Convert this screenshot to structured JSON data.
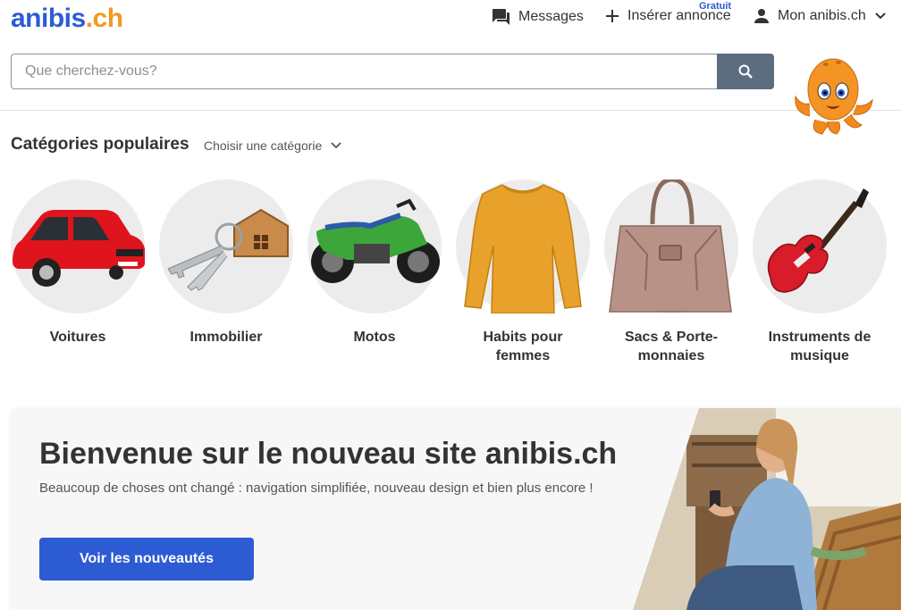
{
  "header": {
    "logo_part1": "anibis",
    "logo_part2": ".ch",
    "nav": {
      "messages": "Messages",
      "insert": "Insérer annonce",
      "insert_badge": "Gratuit",
      "account": "Mon anibis.ch"
    },
    "search": {
      "placeholder": "Que cherchez-vous?"
    }
  },
  "categories": {
    "title": "Catégories populaires",
    "select_label": "Choisir une catégorie",
    "items": [
      {
        "label": "Voitures"
      },
      {
        "label": "Immobilier"
      },
      {
        "label": "Motos"
      },
      {
        "label": "Habits pour femmes"
      },
      {
        "label": "Sacs & Porte-monnaies"
      },
      {
        "label": "Instruments de musique"
      }
    ]
  },
  "banner": {
    "title": "Bienvenue sur le nouveau site anibis.ch",
    "text": "Beaucoup de choses ont changé : navigation simplifiée, nouveau design et bien plus encore !",
    "button": "Voir les nouveautés"
  },
  "colors": {
    "brand_blue": "#2d5bd3",
    "brand_orange": "#f29a22",
    "search_button": "#5c6d80"
  }
}
